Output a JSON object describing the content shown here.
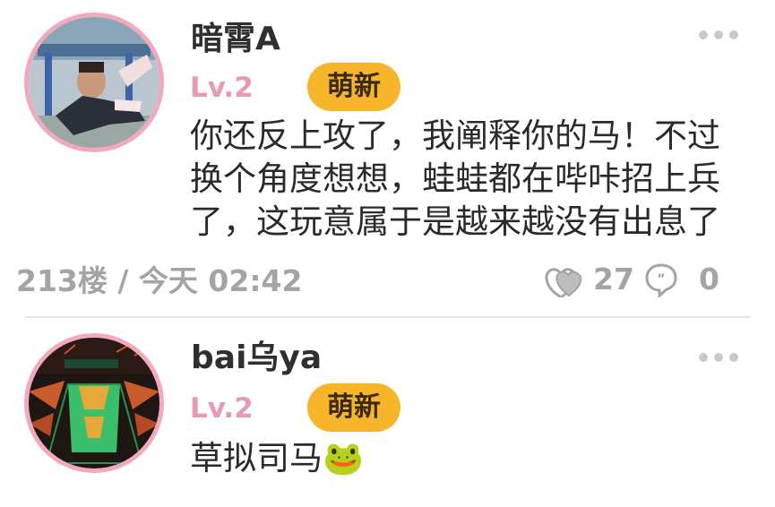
{
  "comments": [
    {
      "username": "暗霄A",
      "level": "Lv.2",
      "badge": "萌新",
      "content": "你还反上攻了，我阐释你的马！不过换个角度想想，蛙蛙都在哔咔招上兵了，这玩意属于是越来越没有出息了",
      "floor_time": "213楼 / 今天 02:42",
      "likes": "27",
      "replies": "0"
    },
    {
      "username": "bai乌ya",
      "level": "Lv.2",
      "badge": "萌新",
      "content": "草拟司马🐸"
    }
  ],
  "colors": {
    "level": "#e89ab0",
    "badge": "#f7b52a",
    "avatar_border": "#f2a9bd",
    "meta_gray": "#a4a4a4"
  },
  "icons": {
    "more": "more-dots-icon",
    "like": "heart-like-icon",
    "reply": "speech-bubble-icon"
  }
}
